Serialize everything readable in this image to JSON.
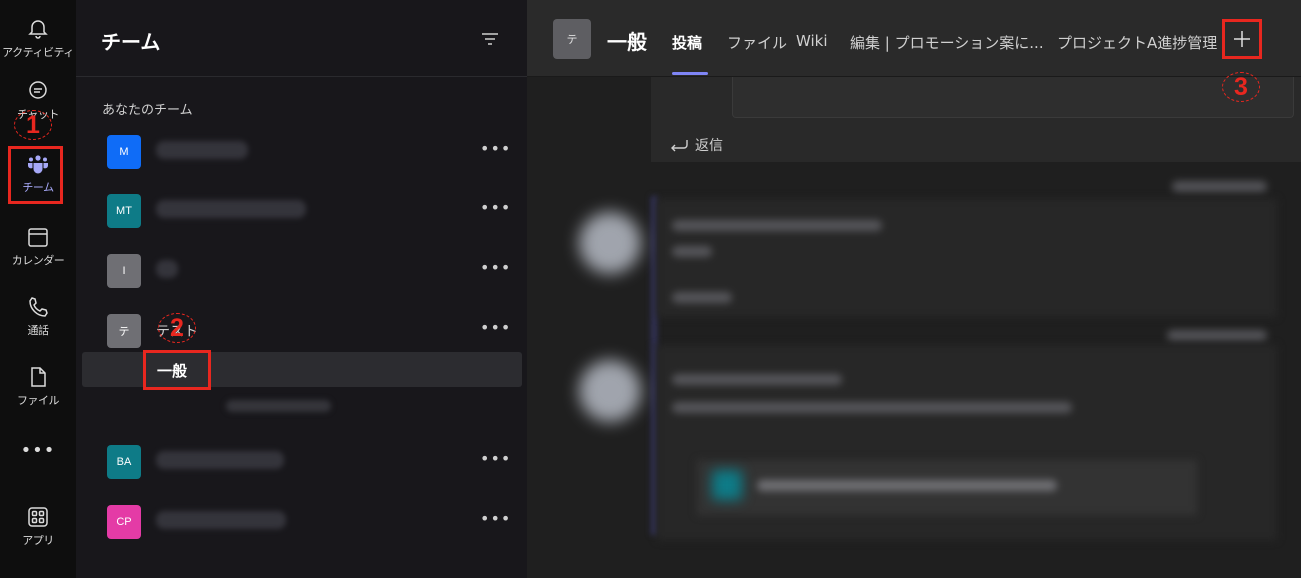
{
  "rail": {
    "items": [
      {
        "label": "アクティビティ"
      },
      {
        "label": "チャット"
      },
      {
        "label": "チーム"
      },
      {
        "label": "カレンダー"
      },
      {
        "label": "通話"
      },
      {
        "label": "ファイル"
      },
      {
        "label": "アプリ"
      }
    ],
    "more": "•••"
  },
  "teams_panel": {
    "title": "チーム",
    "section_label": "あなたのチーム",
    "teams": [
      {
        "initials": "M",
        "color": "#0f6cf7"
      },
      {
        "initials": "MT",
        "color": "#0e7b87"
      },
      {
        "initials": "I",
        "color": "#6f6f74"
      },
      {
        "initials": "テ",
        "color": "#6f6f74",
        "name": "テスト"
      },
      {
        "initials": "BA",
        "color": "#0e7b87"
      },
      {
        "initials": "CP",
        "color": "#e43ba6"
      }
    ],
    "more_label": "•••",
    "selected_channel": "一般"
  },
  "main": {
    "channel_avatar": "テ",
    "channel_title": "一般",
    "tabs": [
      {
        "label": "投稿",
        "active": true
      },
      {
        "label": "ファイル"
      },
      {
        "label": "Wiki"
      },
      {
        "label": "編集 | プロモーション案に..."
      },
      {
        "label": "プロジェクトA進捗管理"
      }
    ],
    "add_tab": "+",
    "reply_label": "返信"
  },
  "annotations": {
    "step1": "1",
    "step2": "2",
    "step3": "3",
    "color": "#e8271f"
  }
}
